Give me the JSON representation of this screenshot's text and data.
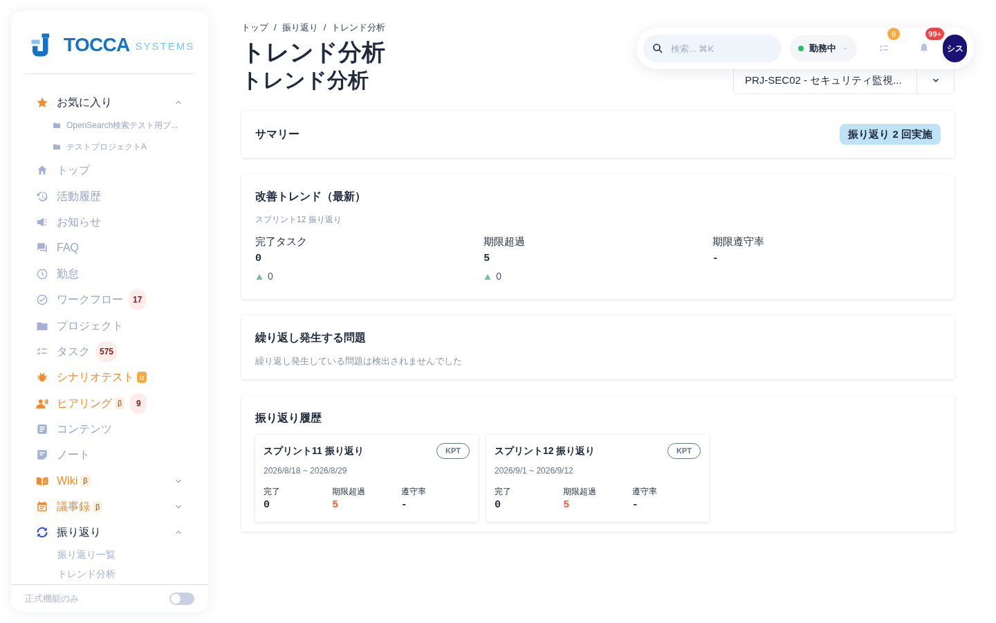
{
  "sidebar": {
    "logo": {
      "mark": "TOCCA",
      "sub": "SYSTEMS"
    },
    "favorites": {
      "label": "お気に入り",
      "expanded": true,
      "children": [
        {
          "label": "OpenSearch検索テスト用プ..."
        },
        {
          "label": "テストプロジェクトA"
        }
      ]
    },
    "items": [
      {
        "label": "トップ",
        "selected": false
      },
      {
        "label": "活動履歴",
        "selected": false
      },
      {
        "label": "お知らせ",
        "selected": false
      },
      {
        "label": "FAQ",
        "selected": false
      },
      {
        "label": "勤怠",
        "selected": false
      },
      {
        "label": "ワークフロー",
        "badge": "17",
        "selected": false
      },
      {
        "label": "プロジェクト",
        "selected": false
      },
      {
        "label": "タスク",
        "badge": "575",
        "selected": false
      },
      {
        "label": "シナリオテスト",
        "tag": "α",
        "color": "#f28c28",
        "selected": false
      },
      {
        "label": "ヒアリング",
        "tag": "β",
        "badge": "9",
        "color": "#f28c28",
        "selected": false
      },
      {
        "label": "コンテンツ",
        "selected": false
      },
      {
        "label": "ノート",
        "selected": false
      },
      {
        "label": "Wiki",
        "tag": "β",
        "color": "#f28c28",
        "expanded": false,
        "selected": false
      },
      {
        "label": "議事録",
        "tag": "β",
        "color": "#f28c28",
        "expanded": false,
        "selected": false
      },
      {
        "label": "振り返り",
        "expanded": true,
        "selected": true,
        "children": [
          {
            "label": "振り返り一覧"
          },
          {
            "label": "トレンド分析"
          }
        ]
      }
    ],
    "footer": {
      "label": "正式機能のみ",
      "on": false
    }
  },
  "breadcrumb": {
    "separator": "/",
    "items": [
      "トップ",
      "振り返り",
      "トレンド分析"
    ]
  },
  "page_title": "トレンド分析",
  "header": {
    "search": {
      "placeholder": "検索... ⌘K"
    },
    "status": {
      "label": "勤務中",
      "color": "#22c55e"
    },
    "tasks_badge": "8",
    "notifications_badge": "99+",
    "avatar": "シス"
  },
  "subtitle": "トレンド分析",
  "project_select": {
    "value": "PRJ-SEC02 - セキュリティ監視..."
  },
  "summary": {
    "title": "サマリー",
    "badge": "振り返り 2 回実施"
  },
  "trend": {
    "title": "改善トレンド（最新）",
    "caption": "スプリント12 振り返り",
    "metrics": [
      {
        "label": "完了タスク",
        "value": "0",
        "delta": "0"
      },
      {
        "label": "期限超過",
        "value": "5",
        "delta": "0"
      },
      {
        "label": "期限遵守率",
        "value": "-"
      }
    ]
  },
  "recurring": {
    "title": "繰り返し発生する問題",
    "message": "繰り返し発生している問題は検出されませんでした"
  },
  "history": {
    "title": "振り返り履歴",
    "cards": [
      {
        "title": "スプリント11 振り返り",
        "tag": "KPT",
        "dates": "2026/8/18 ~ 2026/8/29",
        "stats": [
          {
            "label": "完了",
            "value": "0",
            "alert": false
          },
          {
            "label": "期限超過",
            "value": "5",
            "alert": true
          },
          {
            "label": "遵守率",
            "value": "-",
            "alert": false
          }
        ]
      },
      {
        "title": "スプリント12 振り返り",
        "tag": "KPT",
        "dates": "2026/9/1 ~ 2026/9/12",
        "stats": [
          {
            "label": "完了",
            "value": "0",
            "alert": false
          },
          {
            "label": "期限超過",
            "value": "5",
            "alert": true
          },
          {
            "label": "遵守率",
            "value": "-",
            "alert": false
          }
        ]
      }
    ]
  }
}
